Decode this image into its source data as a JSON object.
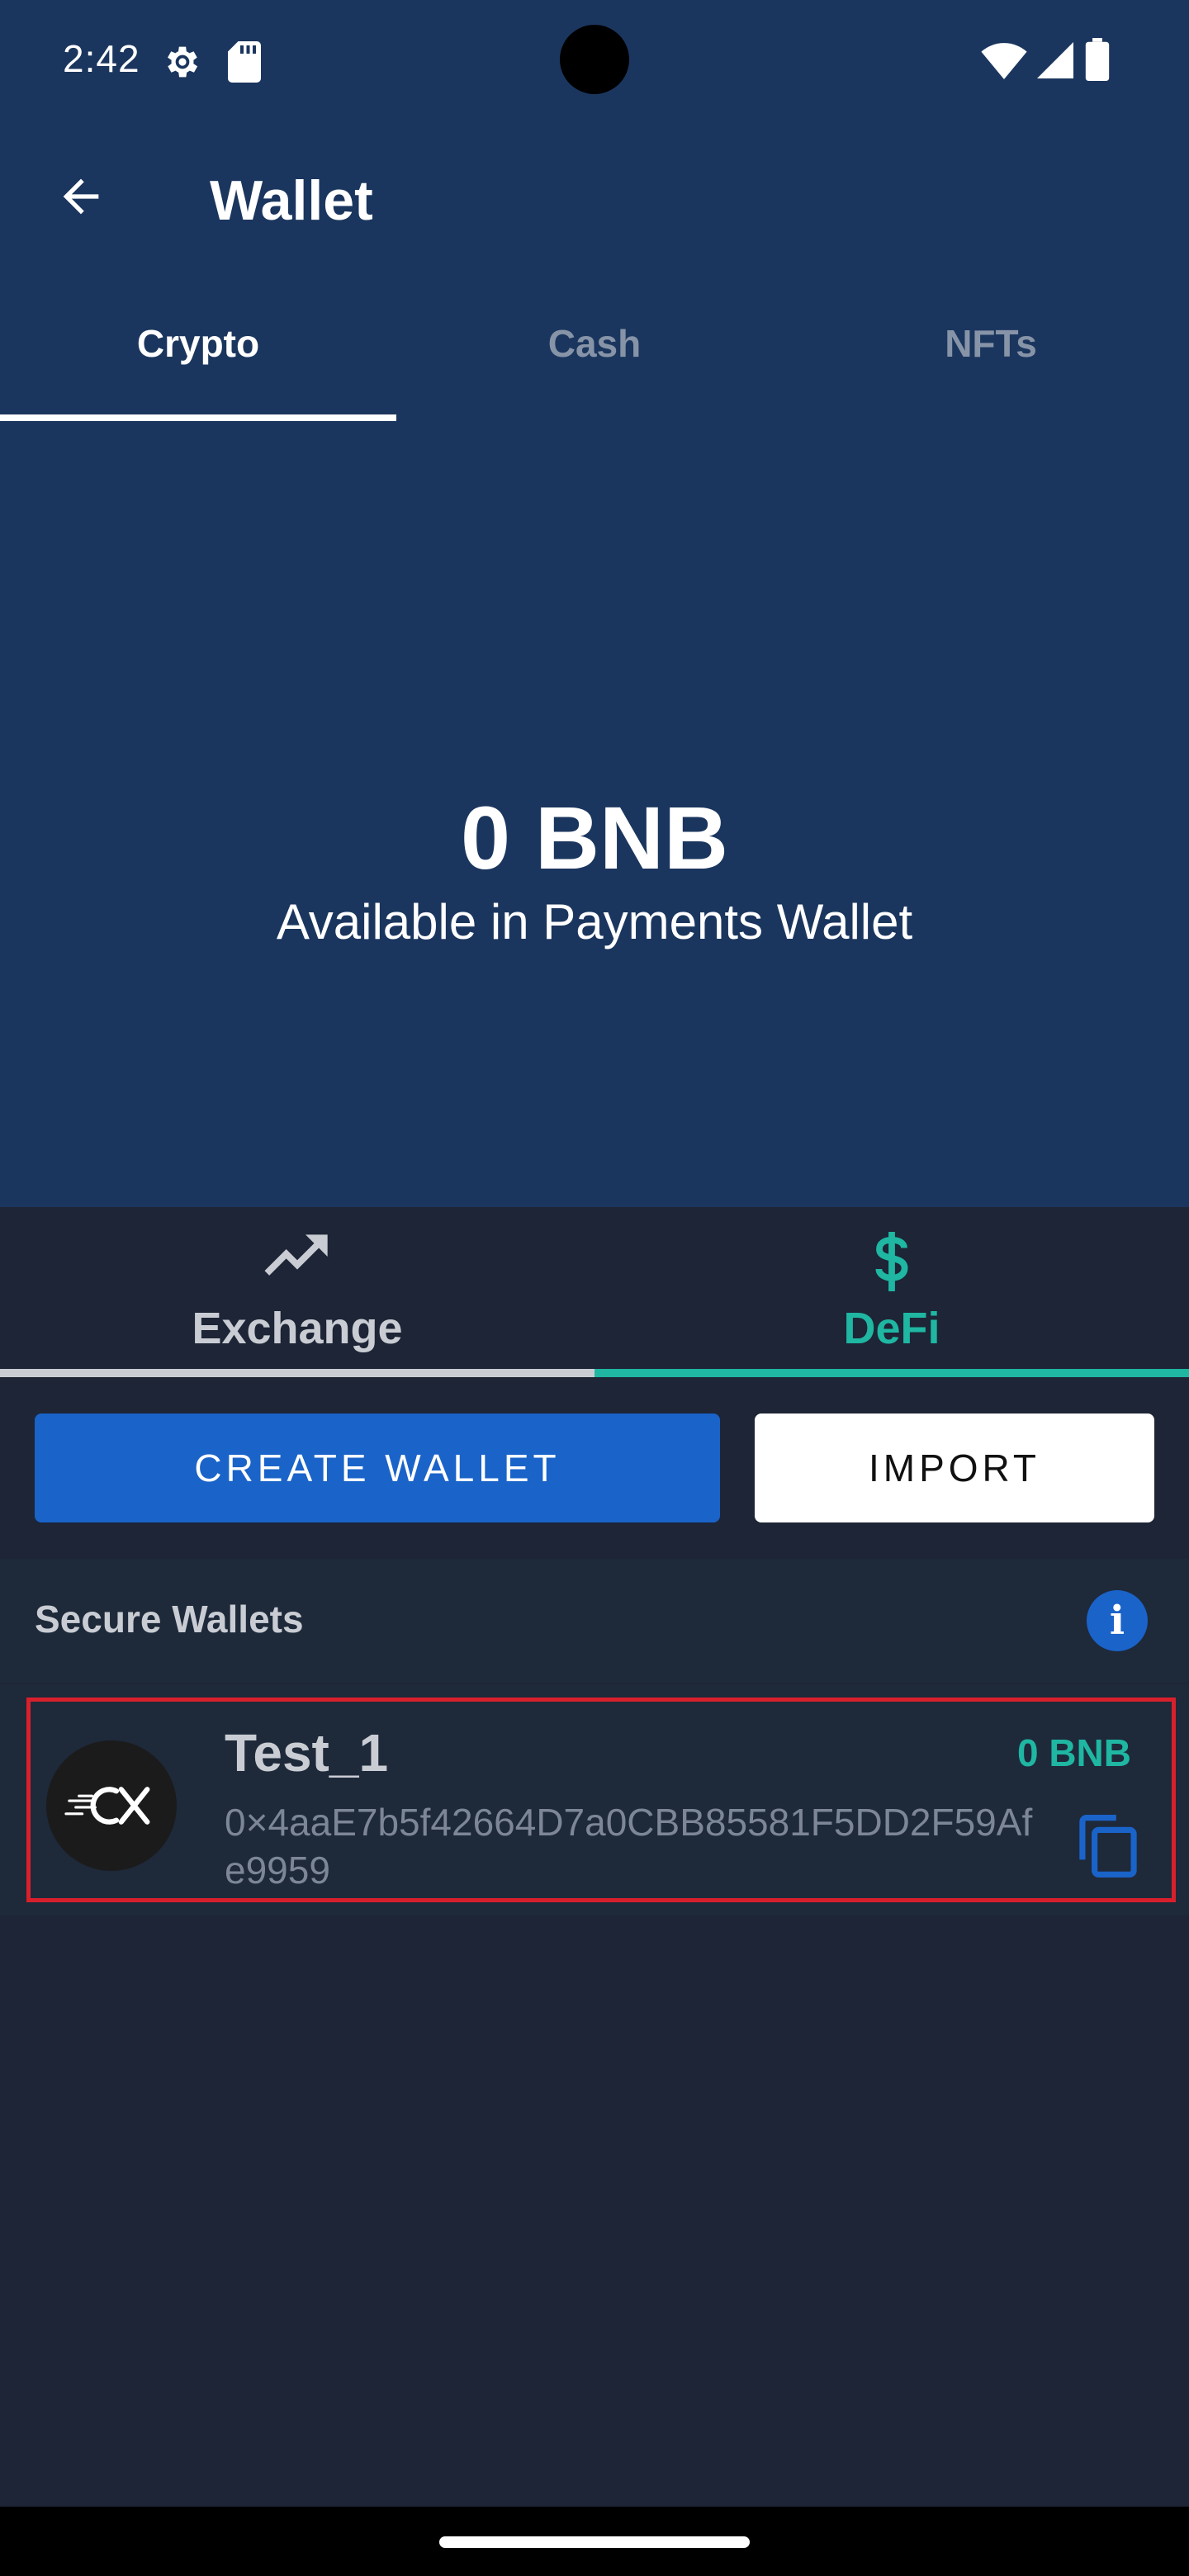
{
  "status_bar": {
    "time": "2:42",
    "icons": [
      "settings-gear-icon",
      "sd-card-icon",
      "wifi-icon",
      "cell-signal-icon",
      "battery-icon"
    ]
  },
  "app_bar": {
    "title": "Wallet",
    "back_icon": "arrow-left-icon"
  },
  "tabs": [
    {
      "label": "Crypto",
      "active": true
    },
    {
      "label": "Cash",
      "active": false
    },
    {
      "label": "NFTs",
      "active": false
    }
  ],
  "balance": {
    "amount": "0 BNB",
    "caption": "Available in Payments Wallet"
  },
  "segments": [
    {
      "label": "Exchange",
      "icon": "trending-up-icon",
      "active": false
    },
    {
      "label": "DeFi",
      "icon": "dollar-sign-icon",
      "active": true
    }
  ],
  "actions": {
    "create_label": "CREATE WALLET",
    "import_label": "IMPORT"
  },
  "secure_wallets": {
    "title": "Secure Wallets",
    "info_icon": "info-icon",
    "wallets": [
      {
        "name": "Test_1",
        "balance": "0 BNB",
        "address": "0×4aaE7b5f42664D7a0CBB85581F5DD2F59Afe9959",
        "logo_text": "CX"
      }
    ]
  },
  "colors": {
    "header_bg": "#1b365e",
    "page_bg": "#1d2536",
    "accent_teal": "#1fb6a2",
    "primary_blue": "#1a63c9",
    "highlight_red": "#d8202c"
  }
}
